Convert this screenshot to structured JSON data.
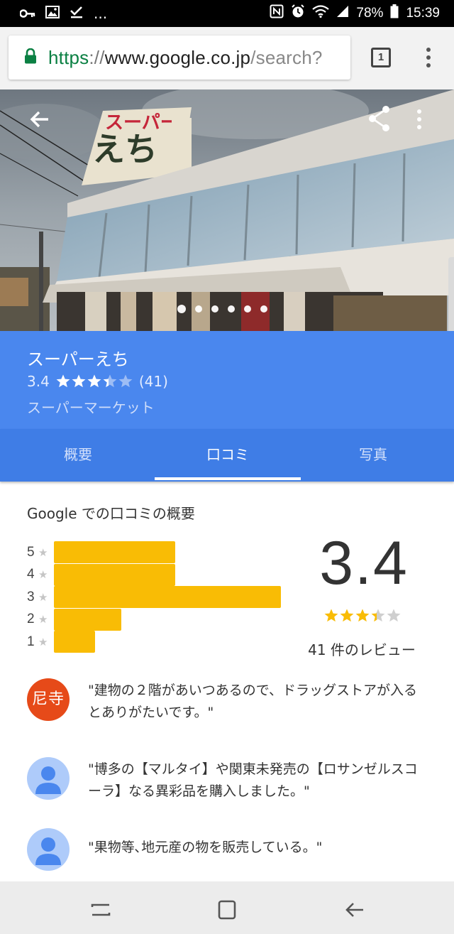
{
  "status_bar": {
    "battery": "78%",
    "time": "15:39",
    "left_icons": [
      "key-icon",
      "image-icon",
      "check-icon"
    ],
    "overflow": "..."
  },
  "browser": {
    "url_scheme": "https",
    "url_sep": "://",
    "url_host": "www.google.co.jp",
    "url_path": "/search?",
    "tab_count": "1",
    "secure": true
  },
  "place": {
    "name": "スーパーえち",
    "rating": "3.4",
    "review_count_paren": "(41)",
    "category": "スーパーマーケット",
    "photo_dots": 6,
    "active_dot": 0
  },
  "tabs": [
    {
      "label": "概要",
      "active": false
    },
    {
      "label": "口コミ",
      "active": true
    },
    {
      "label": "写真",
      "active": false
    }
  ],
  "summary": {
    "title": "Google での口コミの概要",
    "rating": "3.4",
    "review_count": "41 件のレビュー",
    "histogram": [
      {
        "stars": "5",
        "share": 0.47
      },
      {
        "stars": "4",
        "share": 0.47
      },
      {
        "stars": "3",
        "share": 0.88
      },
      {
        "stars": "2",
        "share": 0.26
      },
      {
        "stars": "1",
        "share": 0.16
      }
    ]
  },
  "reviews": [
    {
      "avatar_text": "尼寺",
      "avatar_type": "text",
      "text": "\"建物の２階があいつあるので、ドラッグストアが入るとありがたいです。\""
    },
    {
      "avatar_text": "",
      "avatar_type": "person",
      "text": "\"博多の【マルタイ】や関東未発売の【ロサンゼルスコーラ】なる異彩品を購入しました。\""
    },
    {
      "avatar_text": "",
      "avatar_type": "person",
      "text": "\"果物等､地元産の物を販売している。\""
    }
  ],
  "colors": {
    "header_blue": "#4a87ee",
    "tab_blue": "#3f7de6",
    "bar_yellow": "#f9bc05",
    "star_yellow": "#f9bc05"
  }
}
